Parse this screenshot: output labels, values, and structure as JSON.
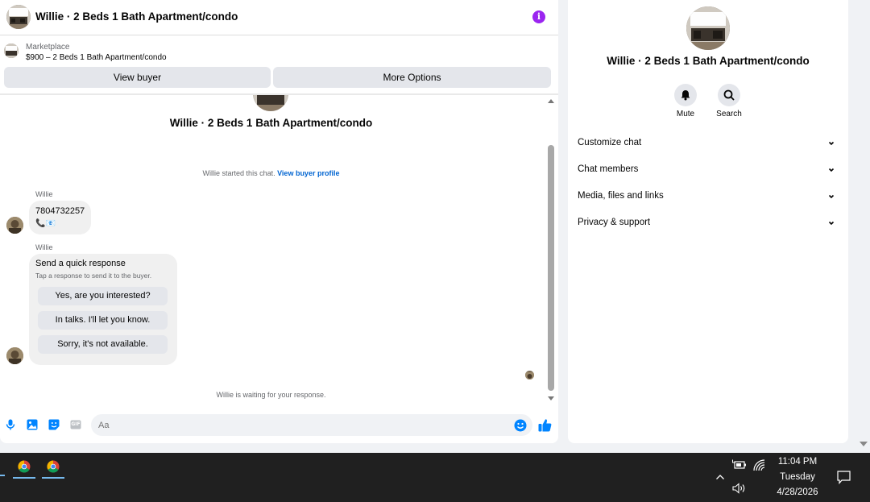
{
  "header": {
    "title": "Willie · 2 Beds 1 Bath Apartment/condo",
    "info_icon": "i"
  },
  "listing": {
    "source": "Marketplace",
    "title": "$900 – 2 Beds 1 Bath Apartment/condo"
  },
  "actions": {
    "view_buyer": "View buyer",
    "more_options": "More Options"
  },
  "thread": {
    "title": "Willie · 2 Beds 1 Bath Apartment/condo",
    "started_text": "Willie started this chat.",
    "started_link": "View buyer profile",
    "messages": [
      {
        "sender": "Willie",
        "text": "7804732257",
        "icons": "📞📧"
      },
      {
        "sender": "Willie",
        "title": "Send a quick response",
        "subtitle": "Tap a response to send it to the buyer.",
        "quick_replies": [
          "Yes, are you interested?",
          "In talks. I'll let you know.",
          "Sorry, it's not available."
        ]
      }
    ],
    "waiting_text": "Willie is waiting for your response."
  },
  "composer": {
    "placeholder": "Aa",
    "icons": [
      "mic-icon",
      "image-icon",
      "sticker-icon",
      "gif-icon",
      "emoji-icon",
      "like-icon"
    ],
    "gif_label": "GIF"
  },
  "details": {
    "title": "Willie · 2 Beds 1 Bath Apartment/condo",
    "mute_label": "Mute",
    "search_label": "Search",
    "sections": [
      "Customize chat",
      "Chat members",
      "Media, files and links",
      "Privacy & support"
    ]
  },
  "taskbar": {
    "time": "11:04 PM",
    "day": "Tuesday",
    "date": "4/28/2026",
    "apps": [
      "chrome-icon",
      "chrome-icon"
    ]
  },
  "colors": {
    "accent": "#0084ff",
    "info_purple": "#9b25f0",
    "link": "#0064d1",
    "taskbar": "#202020"
  }
}
